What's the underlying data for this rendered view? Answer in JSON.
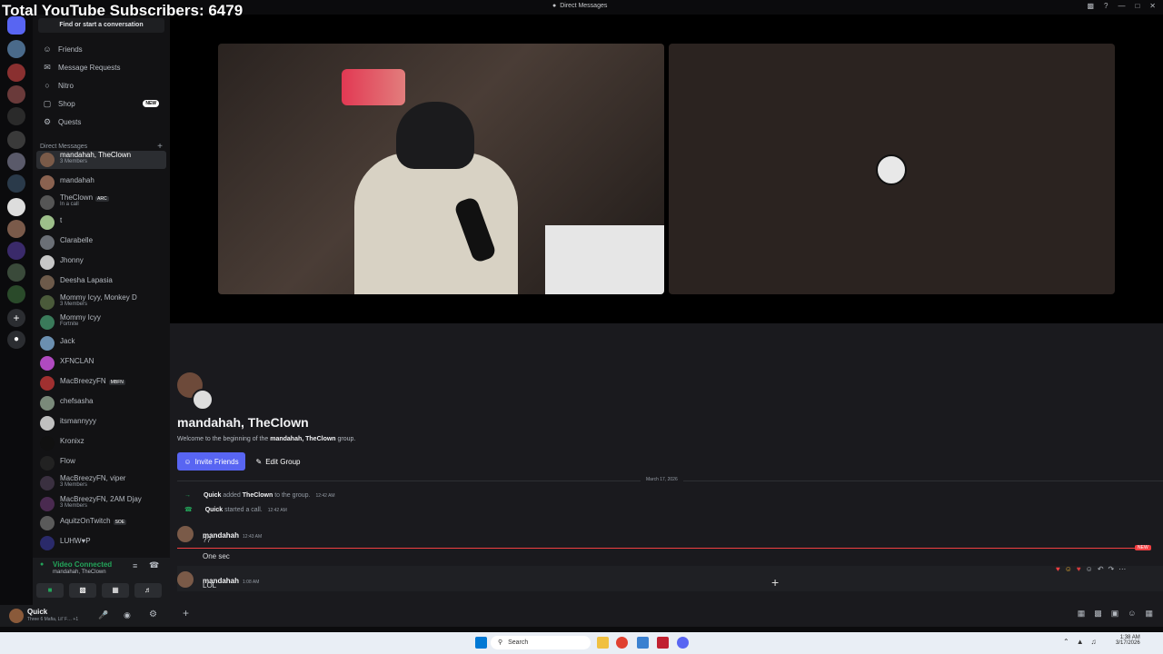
{
  "overlay": {
    "subscribers": "Total YouTube Subscribers: 6479"
  },
  "window": {
    "title": "Direct Messages"
  },
  "search": {
    "label": "Find or start a conversation"
  },
  "nav": [
    {
      "label": "Friends",
      "icon": "friends-icon"
    },
    {
      "label": "Message Requests",
      "icon": "mail-icon"
    },
    {
      "label": "Nitro",
      "icon": "nitro-icon"
    },
    {
      "label": "Shop",
      "icon": "shop-icon",
      "badge": "NEW"
    },
    {
      "label": "Quests",
      "icon": "quests-icon"
    }
  ],
  "dm_section": {
    "header": "Direct Messages",
    "add": "+"
  },
  "dms": [
    {
      "name": "mandahah, TheClown",
      "sub": "3 Members",
      "active": true,
      "color": "#7a5a48"
    },
    {
      "name": "mandahah",
      "sub": "",
      "color": "#8a6250"
    },
    {
      "name": "TheClown",
      "tag": "ARC",
      "sub": "In a call",
      "color": "#555"
    },
    {
      "name": "t",
      "sub": "",
      "color": "#9dbf8a"
    },
    {
      "name": "Clarabelle",
      "sub": "",
      "color": "#6b6f76"
    },
    {
      "name": "Jhonny",
      "sub": "",
      "color": "#c7c7c7"
    },
    {
      "name": "Deesha Lapasia",
      "sub": "",
      "color": "#6d5a4a"
    },
    {
      "name": "Mommy Icyy, Monkey D",
      "sub": "3 Members",
      "color": "#4a5a3a"
    },
    {
      "name": "Mommy Icyy",
      "sub": "Fortnite",
      "color": "#3a7a5a"
    },
    {
      "name": "Jack",
      "sub": "",
      "color": "#6b8fb0"
    },
    {
      "name": "XFNCLAN",
      "sub": "",
      "color": "#b04ac0"
    },
    {
      "name": "MacBreezyFN",
      "tag": "MBFN",
      "sub": "",
      "color": "#a03030"
    },
    {
      "name": "chefsasha",
      "sub": "",
      "color": "#7a8a7a"
    },
    {
      "name": "itsmannyyy",
      "sub": "",
      "color": "#c0c0c0"
    },
    {
      "name": "Kronixz",
      "sub": "",
      "color": "#111"
    },
    {
      "name": "Flow",
      "sub": "",
      "color": "#222"
    },
    {
      "name": "MacBreezyFN, viper",
      "sub": "3 Members",
      "color": "#3a3040"
    },
    {
      "name": "MacBreezyFN, 2AM Djay",
      "sub": "3 Members",
      "color": "#4a2a50"
    },
    {
      "name": "AquitzOnTwitch",
      "tag": "SOE",
      "sub": "",
      "color": "#5a5a5a"
    },
    {
      "name": "LUHW♥P",
      "sub": "",
      "color": "#2a2a6a"
    }
  ],
  "voice": {
    "status": "Video Connected",
    "channel": "mandahah, TheClown"
  },
  "user": {
    "name": "Quick",
    "status": "Three 6 Mafia, Lil' F… +1"
  },
  "chat": {
    "group_title": "mandahah, TheClown",
    "welcome_pre": "Welcome to the beginning of the",
    "welcome_bold": "mandahah, TheClown",
    "welcome_post": "group.",
    "invite_label": "Invite Friends",
    "edit_label": "Edit Group",
    "date_divider": "March 17, 2026",
    "system": [
      {
        "actor": "Quick",
        "text1": "added",
        "target": "TheClown",
        "text2": "to the group.",
        "time": "12:42 AM"
      },
      {
        "actor": "Quick",
        "text1": "started a call.",
        "target": "",
        "text2": "",
        "time": "12:42 AM"
      }
    ],
    "messages": [
      {
        "user": "mandahah",
        "time": "12:43 AM",
        "lines": [
          "??"
        ]
      },
      {
        "user": "",
        "time": "",
        "lines": [
          "One sec"
        ]
      },
      {
        "user": "mandahah",
        "time": "1:08 AM",
        "lines": [
          "LOL"
        ]
      }
    ],
    "new_marker": "NEW"
  },
  "taskbar": {
    "search": "Search",
    "time": "1:38 AM",
    "date": "3/17/2026"
  }
}
